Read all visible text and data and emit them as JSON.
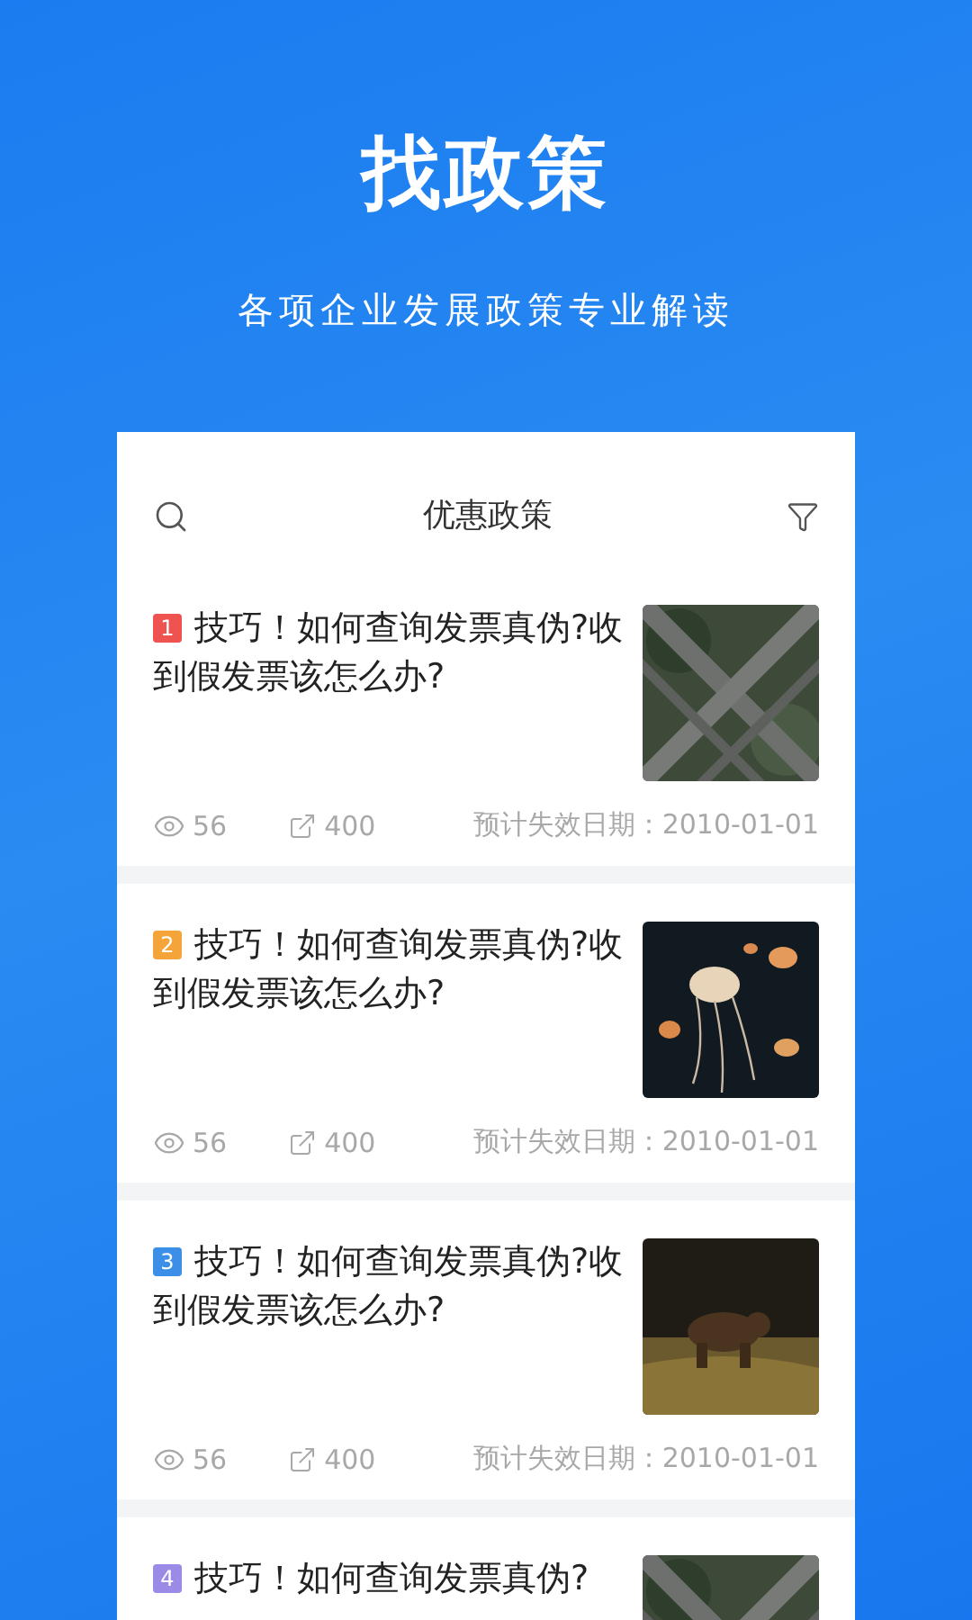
{
  "hero": {
    "title": "找政策",
    "subtitle": "各项企业发展政策专业解读"
  },
  "card": {
    "title": "优惠政策"
  },
  "items": [
    {
      "number": "1",
      "color": "#ef5350",
      "title": "技巧！如何查询发票真伪?收到假发票该怎么办?",
      "views": "56",
      "shares": "400",
      "expiry": "预计失效日期：2010-01-01"
    },
    {
      "number": "2",
      "color": "#f5a43a",
      "title": "技巧！如何查询发票真伪?收到假发票该怎么办?",
      "views": "56",
      "shares": "400",
      "expiry": "预计失效日期：2010-01-01"
    },
    {
      "number": "3",
      "color": "#3b8fe6",
      "title": "技巧！如何查询发票真伪?收到假发票该怎么办?",
      "views": "56",
      "shares": "400",
      "expiry": "预计失效日期：2010-01-01"
    },
    {
      "number": "4",
      "color": "#9b8ae6",
      "title": "技巧！如何查询发票真伪?"
    }
  ]
}
